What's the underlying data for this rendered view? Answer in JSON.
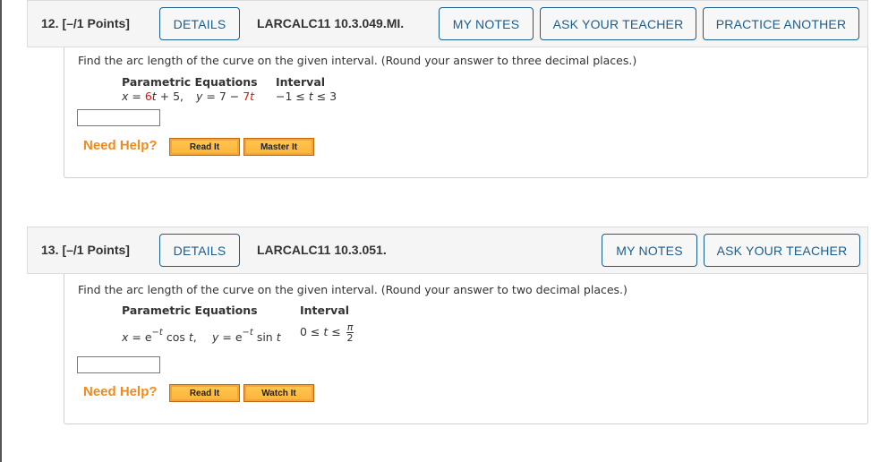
{
  "questions": [
    {
      "number": "12.",
      "points": "[–/1 Points]",
      "details_label": "DETAILS",
      "code": "LARCALC11 10.3.049.MI.",
      "my_notes_label": "MY NOTES",
      "ask_teacher_label": "ASK YOUR TEACHER",
      "practice_another_label": "PRACTICE ANOTHER",
      "prompt": "Find the arc length of the curve on the given interval. (Round your answer to three decimal places.)",
      "col_equations": "Parametric Equations",
      "col_interval": "Interval",
      "x_eq": {
        "lhs": "x",
        "eq": " = ",
        "coef": "6",
        "var": "t",
        "rest": " + 5,"
      },
      "y_eq": {
        "lhs": "y",
        "eq": " = 7 − ",
        "coef": "7",
        "var": "t"
      },
      "interval": {
        "left": "−1 ≤ ",
        "var": "t",
        "right": " ≤ 3"
      },
      "answer_value": "",
      "need_help": "Need Help?",
      "help_buttons": [
        "Read It",
        "Master It"
      ]
    },
    {
      "number": "13.",
      "points": "[–/1 Points]",
      "details_label": "DETAILS",
      "code": "LARCALC11 10.3.051.",
      "my_notes_label": "MY NOTES",
      "ask_teacher_label": "ASK YOUR TEACHER",
      "prompt": "Find the arc length of the curve on the given interval. (Round your answer to two decimal places.)",
      "col_equations": "Parametric Equations",
      "col_interval": "Interval",
      "x_eq": {
        "lhs": "x",
        "eq": " = e",
        "exp": "−t",
        "func": " cos ",
        "var": "t",
        "tail": ","
      },
      "y_eq": {
        "lhs": "y",
        "eq": " = e",
        "exp": "−t",
        "func": " sin ",
        "var": "t"
      },
      "interval": {
        "left": "0 ≤ ",
        "var": "t",
        "mid": " ≤ ",
        "num": "π",
        "den": "2"
      },
      "answer_value": "",
      "need_help": "Need Help?",
      "help_buttons": [
        "Read It",
        "Watch It"
      ]
    }
  ],
  "colors": {
    "accent": "#1a5e8e",
    "highlight_red": "#e3120b",
    "help_orange": "#f08a1c",
    "help_button": "#fbb33a"
  }
}
